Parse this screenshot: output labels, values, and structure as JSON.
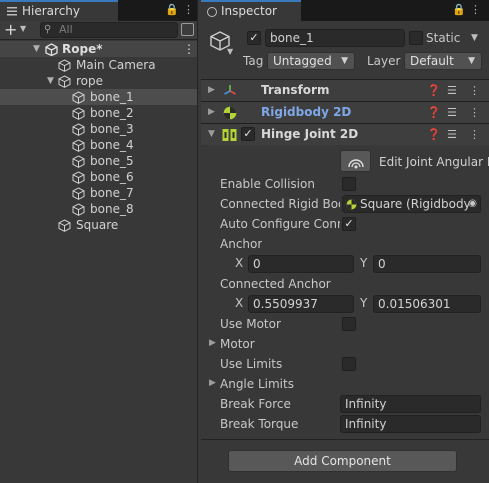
{
  "hierarchy": {
    "tab_title": "Hierarchy",
    "search_placeholder": "All",
    "add_label": "+",
    "scene_name": "Rope*",
    "items": [
      {
        "label": "Main Camera"
      },
      {
        "label": "rope"
      },
      {
        "label": "bone_1"
      },
      {
        "label": "bone_2"
      },
      {
        "label": "bone_3"
      },
      {
        "label": "bone_4"
      },
      {
        "label": "bone_5"
      },
      {
        "label": "bone_6"
      },
      {
        "label": "bone_7"
      },
      {
        "label": "bone_8"
      },
      {
        "label": "Square"
      }
    ],
    "selected": "bone_1"
  },
  "inspector": {
    "tab_title": "Inspector",
    "object_name": "bone_1",
    "static_label": "Static",
    "tag_label": "Tag",
    "tag_value": "Untagged",
    "layer_label": "Layer",
    "layer_value": "Default",
    "components": [
      {
        "name": "Transform"
      },
      {
        "name": "Rigidbody 2D"
      },
      {
        "name": "Hinge Joint 2D"
      }
    ],
    "hinge": {
      "edit_joint_label": "Edit Joint Angular L",
      "enable_collision": "Enable Collision",
      "connected_rigid_body": "Connected Rigid Bod",
      "connected_rigid_body_value": "Square (Rigidbody",
      "auto_configure": "Auto Configure Conn",
      "anchor": "Anchor",
      "anchor_x": "0",
      "anchor_y": "0",
      "connected_anchor": "Connected Anchor",
      "connected_anchor_x": "0.5509937",
      "connected_anchor_y": "0.01506301",
      "use_motor": "Use Motor",
      "motor": "Motor",
      "use_limits": "Use Limits",
      "angle_limits": "Angle Limits",
      "break_force": "Break Force",
      "break_force_value": "Infinity",
      "break_torque": "Break Torque",
      "break_torque_value": "Infinity",
      "x_label": "X",
      "y_label": "Y"
    },
    "add_component": "Add Component"
  },
  "colors": {
    "accent": "#3a79bb",
    "link_blue": "#7fa7e6",
    "panel": "#383838"
  }
}
